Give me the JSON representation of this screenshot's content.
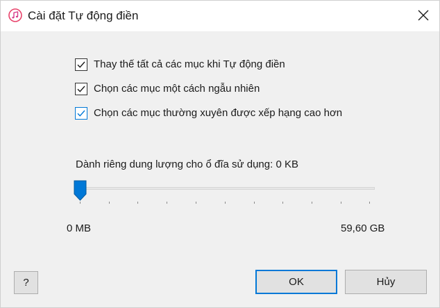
{
  "window": {
    "title": "Cài đặt Tự động điền",
    "app_icon": "itunes-music-note-icon",
    "close_icon": "close-icon"
  },
  "options": [
    {
      "label": "Thay thế tất cả các mục khi Tự động điền",
      "checked": true
    },
    {
      "label": "Chọn các mục một cách ngẫu nhiên",
      "checked": true
    },
    {
      "label": "Chọn các mục thường xuyên được xếp hạng cao hơn",
      "checked": true
    }
  ],
  "storage": {
    "reserve_label": "Dành riêng dung lượng cho ổ đĩa sử dụng: 0 KB",
    "slider_fraction": 0,
    "min_label": "0 MB",
    "max_label": "59,60 GB"
  },
  "buttons": {
    "help": "?",
    "ok": "OK",
    "cancel": "Hủy"
  },
  "colors": {
    "accent": "#0078d7",
    "app_icon": "#e8436b"
  }
}
